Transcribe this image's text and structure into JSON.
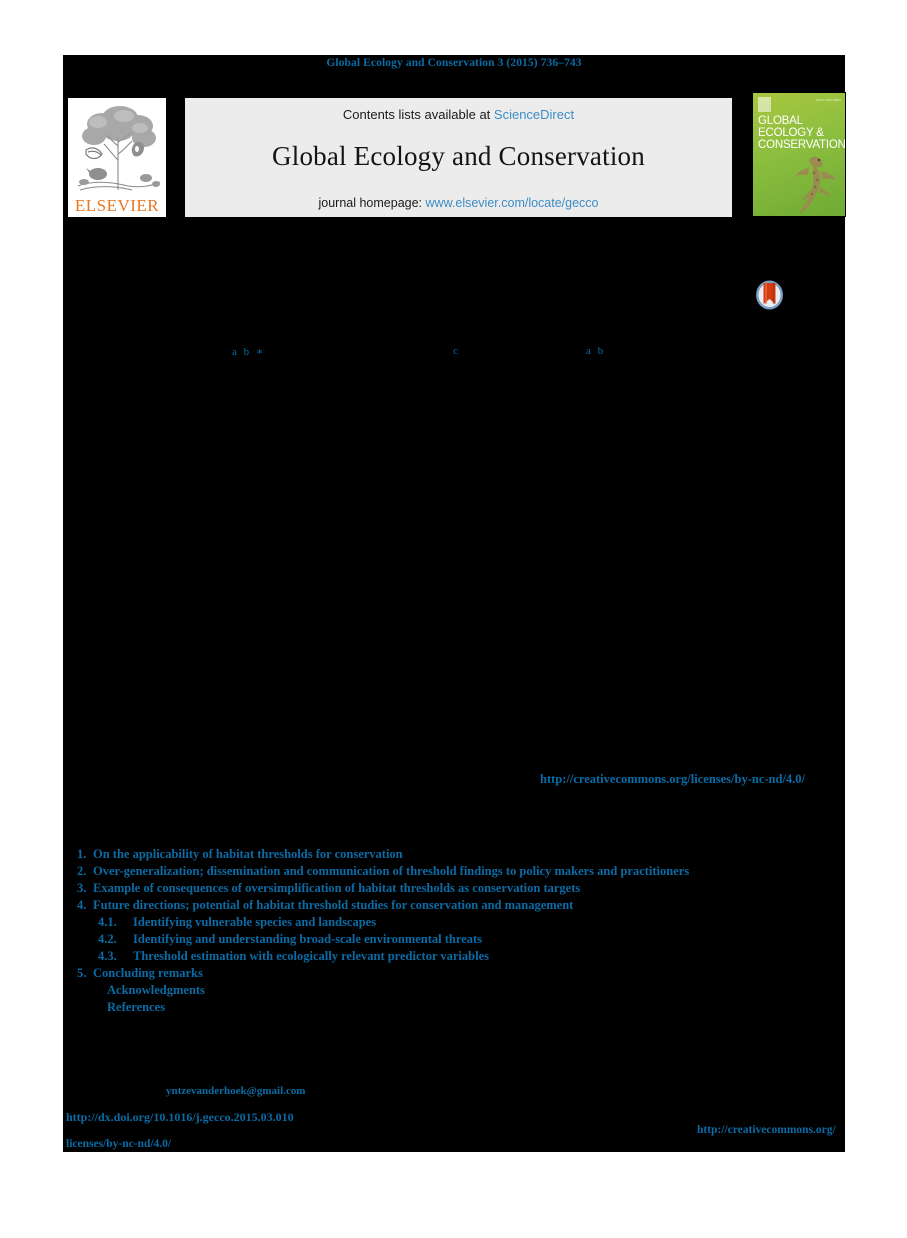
{
  "running_head": "Global Ecology and Conservation 3 (2015) 736–743",
  "masthead": {
    "contents_prefix": "Contents lists available at ",
    "sciencedirect_link": "ScienceDirect",
    "journal_title": "Global Ecology and Conservation",
    "homepage_prefix": "journal homepage: ",
    "homepage_url": "www.elsevier.com/locate/gecco",
    "publisher_wordmark": "ELSEVIER",
    "publisher_logo_icon": "elsevier-tree-icon"
  },
  "cover": {
    "title_line_1": "GLOBAL",
    "title_line_2": "ECOLOGY &",
    "title_line_3": "CONSERVATION",
    "issn_text": "ISSN 2351-9894",
    "art_icon": "gecko-lizard-icon",
    "publisher_mark_icon": "elsevier-mark-icon"
  },
  "crossmark": {
    "icon": "crossmark-badge-icon",
    "label": "CrossMark"
  },
  "authors": {
    "affiliation_marks": [
      {
        "id": "affil-1",
        "text": "a b ∗"
      },
      {
        "id": "affil-2",
        "text": "c"
      },
      {
        "id": "affil-3",
        "text": "a b"
      }
    ]
  },
  "abstract": {
    "license_url": "http://creativecommons.org/licenses/by-nc-nd/4.0/"
  },
  "contents": {
    "items": [
      {
        "number": "1.",
        "label": "On the applicability of habitat thresholds for conservation",
        "level": 1
      },
      {
        "number": "2.",
        "label": "Over-generalization; dissemination and communication of threshold findings to policy makers and practitioners",
        "level": 1
      },
      {
        "number": "3.",
        "label": "Example of consequences of oversimplification of habitat thresholds as conservation targets",
        "level": 1
      },
      {
        "number": "4.",
        "label": "Future directions; potential of habitat threshold studies for conservation and management",
        "level": 1
      },
      {
        "number": "4.1.",
        "label": "Identifying vulnerable species and landscapes",
        "level": 2
      },
      {
        "number": "4.2.",
        "label": "Identifying and understanding broad-scale environmental threats",
        "level": 2
      },
      {
        "number": "4.3.",
        "label": "Threshold estimation with ecologically relevant predictor variables",
        "level": 2
      },
      {
        "number": "5.",
        "label": "Concluding remarks",
        "level": 1
      },
      {
        "number": "",
        "label": "Acknowledgments",
        "level": 0
      },
      {
        "number": "",
        "label": "References",
        "level": 0
      }
    ]
  },
  "footer": {
    "corresponding_email": "yntzevanderhoek@gmail.com",
    "doi_url": "http://dx.doi.org/10.1016/j.gecco.2015.03.010",
    "license_url_part_1": "http://creativecommons.org/",
    "license_url_part_2": "licenses/by-nc-nd/4.0/"
  },
  "colors": {
    "link_blue": "#0b6ba5",
    "sciencedirect_blue": "#3c8dc5",
    "elsevier_orange": "#e87722",
    "banner_grey": "#ececec",
    "page_black": "#000000"
  }
}
